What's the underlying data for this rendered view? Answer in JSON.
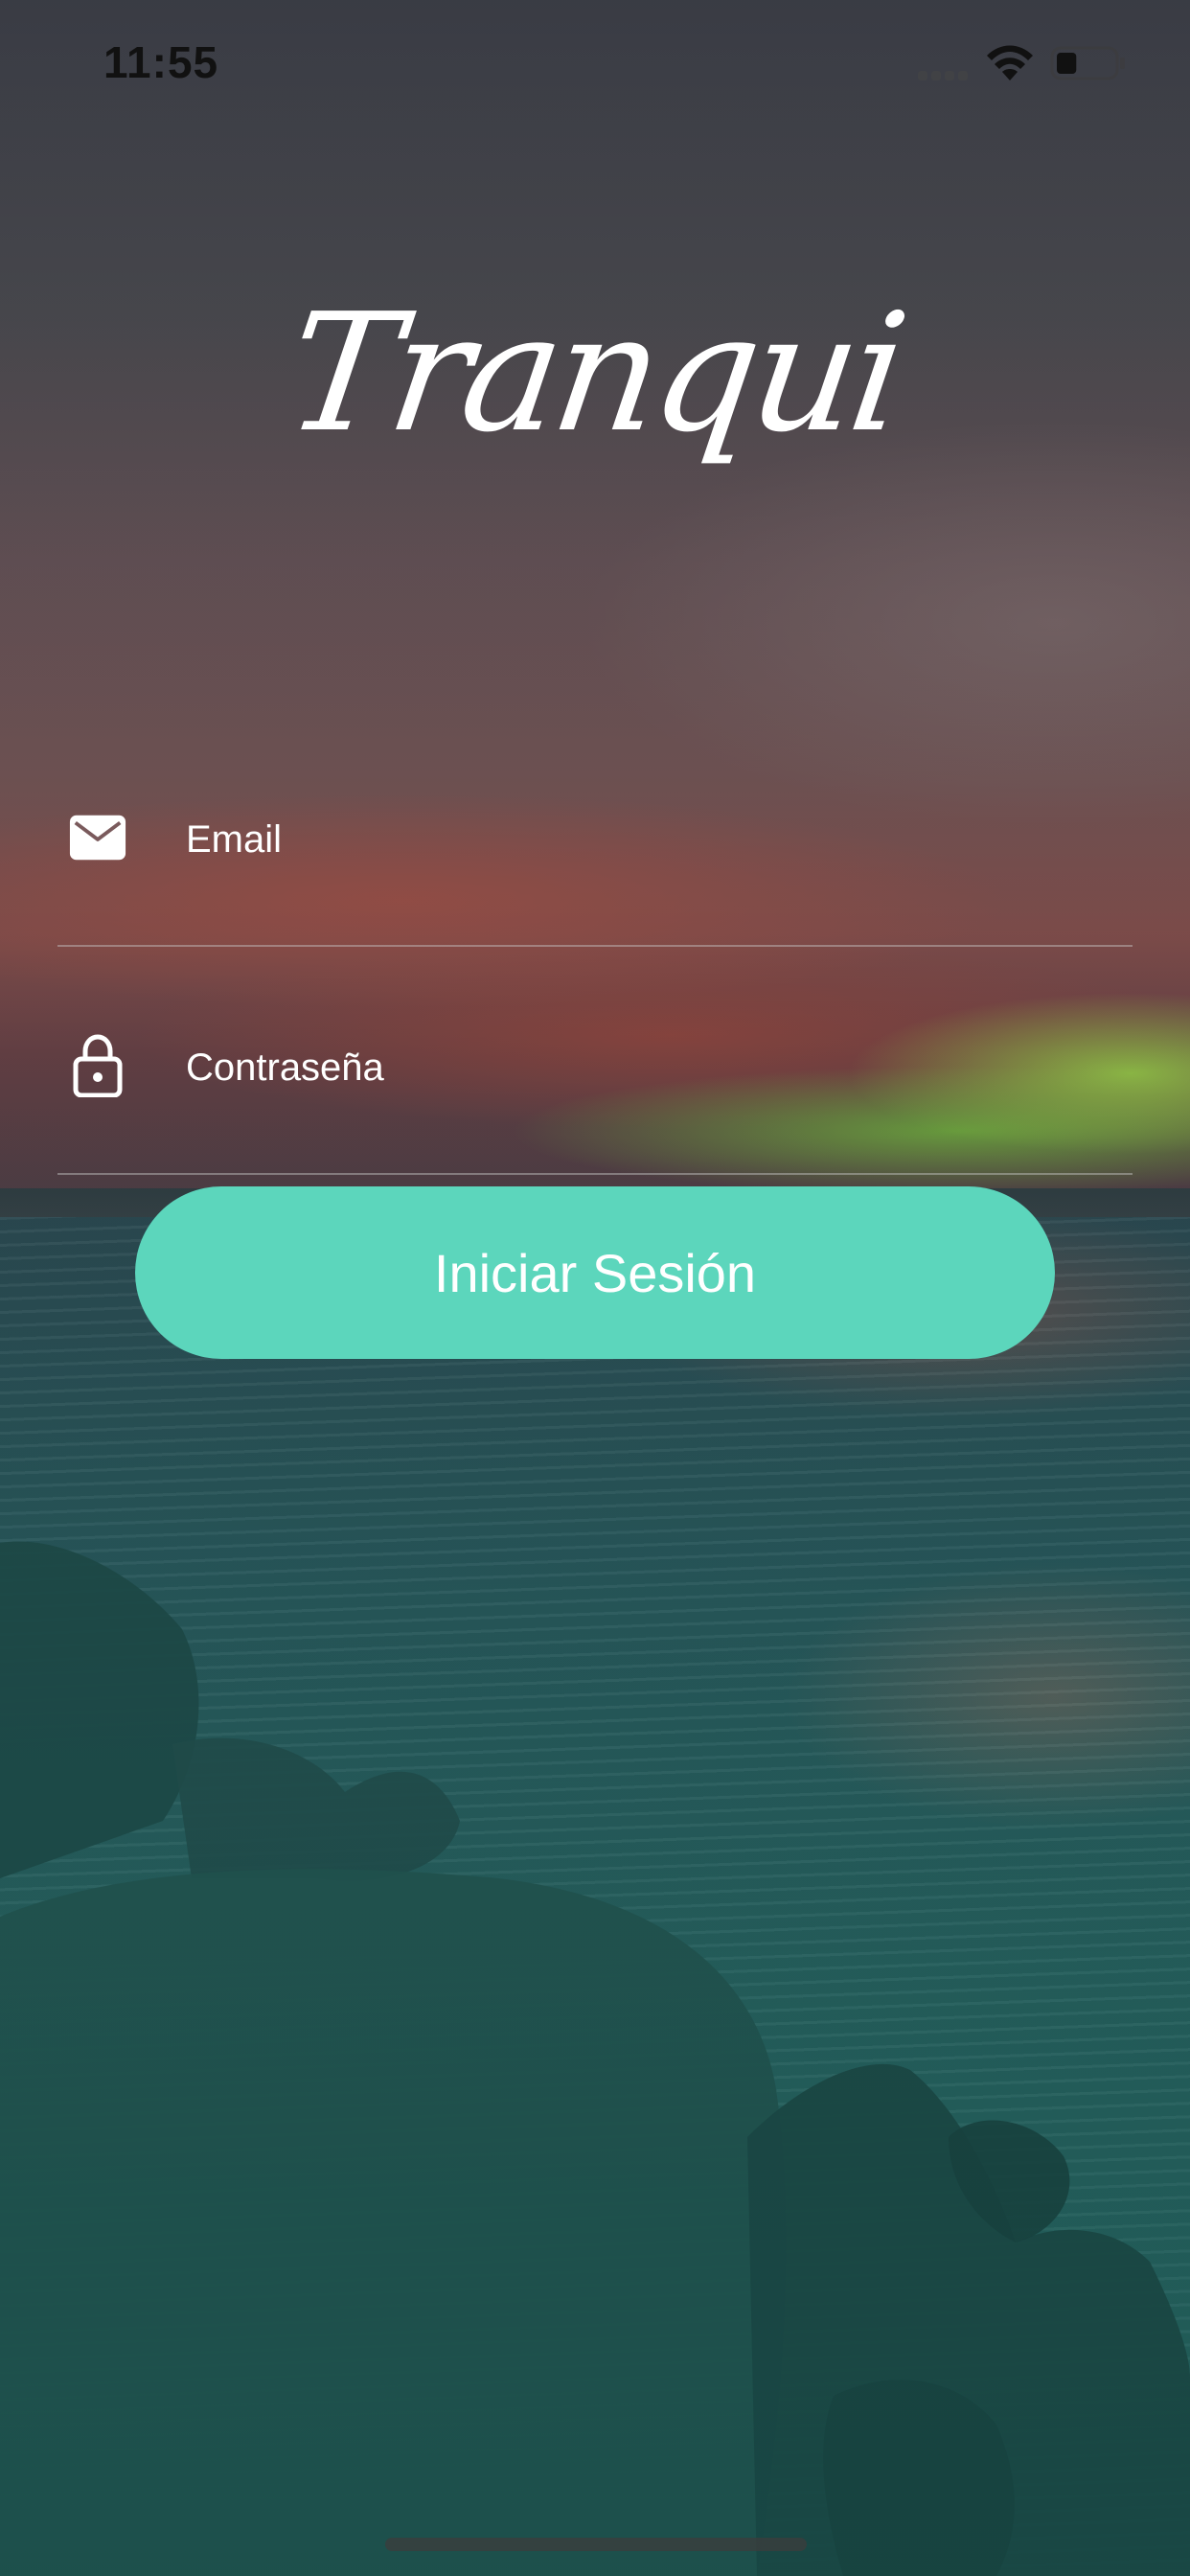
{
  "status_bar": {
    "time": "11:55",
    "wifi_icon": "wifi-icon",
    "battery_icon": "battery-icon",
    "signal_icon": "cellular-signal-icon",
    "battery_level": 0.35
  },
  "logo": {
    "text": "Tranqui"
  },
  "form": {
    "email": {
      "placeholder": "Email",
      "value": "",
      "icon": "envelope-icon"
    },
    "password": {
      "placeholder": "Contraseña",
      "value": "",
      "icon": "lock-icon"
    },
    "submit_label": "Iniciar Sesión"
  },
  "colors": {
    "accent": "#5cd6bc",
    "text": "#ffffff",
    "status_text": "#111111"
  }
}
